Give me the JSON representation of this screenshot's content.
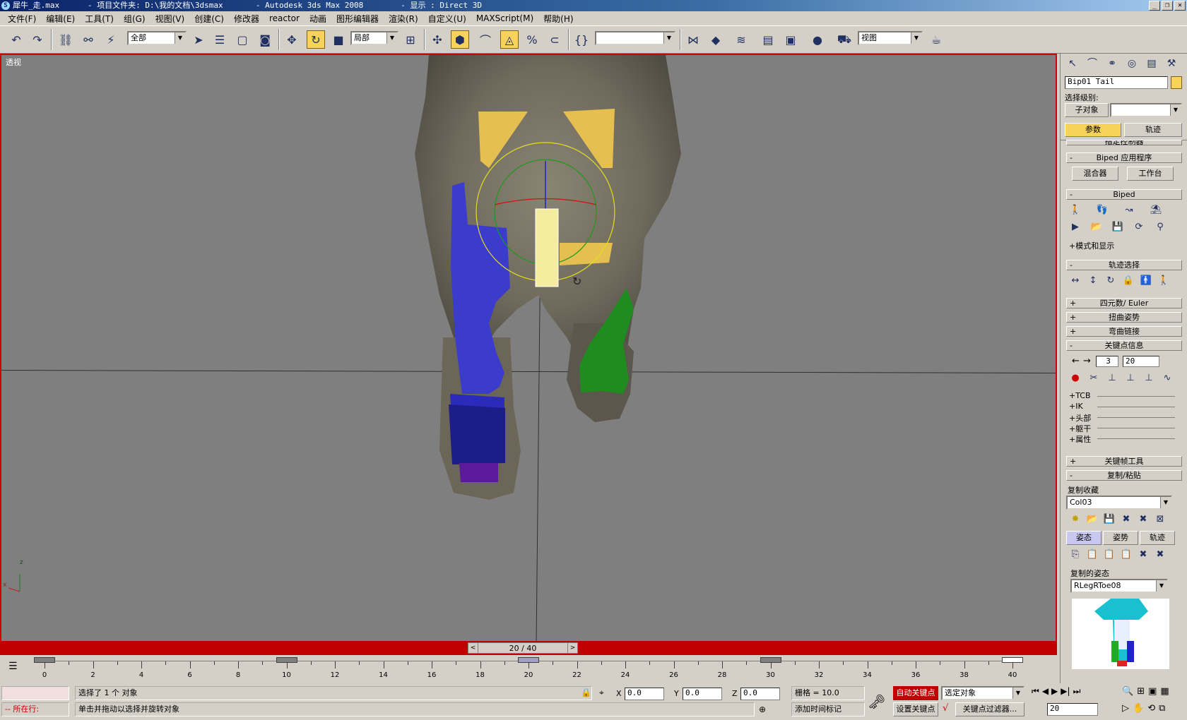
{
  "window": {
    "title": "犀牛_走.max      - 项目文件夹: D:\\我的文档\\3dsmax       - Autodesk 3ds Max 2008        - 显示 : Direct 3D",
    "app_icon": "3ds-max-icon"
  },
  "menu": [
    "文件(F)",
    "编辑(E)",
    "工具(T)",
    "组(G)",
    "视图(V)",
    "创建(C)",
    "修改器",
    "reactor",
    "动画",
    "图形编辑器",
    "渲染(R)",
    "自定义(U)",
    "MAXScript(M)",
    "帮助(H)"
  ],
  "toolbar": {
    "selection_filter": "全部",
    "coord_system": "局部",
    "named_selection": "",
    "viewport_select": "视图"
  },
  "viewport": {
    "label": "透视",
    "axis_x": "x",
    "axis_z": "z"
  },
  "time_slider": {
    "label": "20 / 40",
    "current_frame": 20,
    "total_frames": 40
  },
  "trackbar": {
    "ticks": [
      "0",
      "2",
      "4",
      "6",
      "8",
      "10",
      "12",
      "14",
      "16",
      "18",
      "20",
      "22",
      "24",
      "26",
      "28",
      "30",
      "32",
      "34",
      "36",
      "38",
      "40"
    ]
  },
  "status": {
    "selected_text": "选择了 1 个 对象",
    "prompt_text": "单击并拖动以选择并旋转对象",
    "script_label": "-- 所在行:",
    "x_label": "X",
    "x_value": "0.0",
    "y_label": "Y",
    "y_value": "0.0",
    "z_label": "Z",
    "z_value": "0.0",
    "grid_text": "栅格 = 10.0",
    "auto_key": "自动关键点",
    "set_key": "设置关键点",
    "key_filter": "选定对象",
    "key_filters_btn": "关键点过滤器...",
    "add_time_tag": "添加时间标记",
    "frame_value": "20"
  },
  "panel": {
    "object_name": "Bip01 Tail",
    "sel_level_label": "选择级别:",
    "sub_object": "子对象",
    "tab_params": "参数",
    "tab_track": "轨迹",
    "rollout_cut": "指定控制器",
    "biped_apps": "Biped 应用程序",
    "mixer": "混合器",
    "workbench": "工作台",
    "biped": "Biped",
    "mode_display": "模式和显示",
    "track_select": "轨迹选择",
    "quat_euler": "四元数/ Euler",
    "twist_poses": "扭曲姿势",
    "bend_links": "弯曲链接",
    "key_info": "关键点信息",
    "key_num": "3",
    "key_frame": "20",
    "key_subs": [
      "TCB",
      "IK",
      "头部",
      "躯干",
      "属性"
    ],
    "keyframe_tools": "关键帧工具",
    "copy_paste": "复制/粘贴",
    "copy_collection": "复制收藏",
    "collection_value": "Col03",
    "cp_tab_pose": "姿态",
    "cp_tab_posture": "姿势",
    "cp_tab_track": "轨迹",
    "copied_poses": "复制的姿态",
    "pose_value": "RLegRToe08"
  },
  "colors": {
    "accent": "#f7d35c",
    "viewport_border": "#d00000",
    "timebar": "#c00000"
  }
}
